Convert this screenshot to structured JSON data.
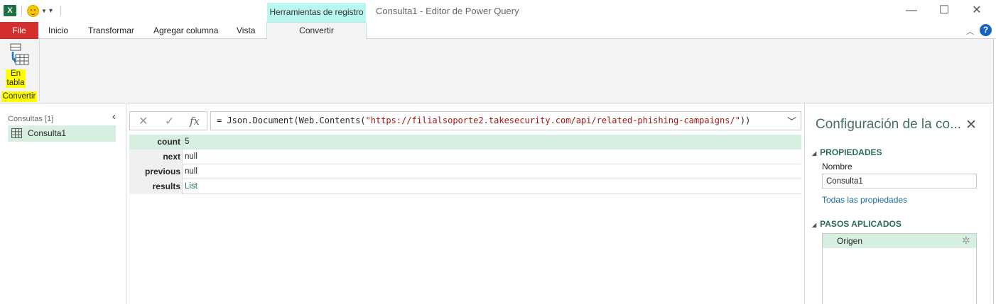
{
  "titlebar": {
    "app_logo": "X",
    "contextual_tab_header": "Herramientas de registro",
    "window_title": "Consulta1 - Editor de Power Query",
    "window_buttons": {
      "minimize": "—",
      "maximize": "☐",
      "close": "✕"
    }
  },
  "tabs": {
    "file": "File",
    "items": [
      "Inicio",
      "Transformar",
      "Agregar columna",
      "Vista"
    ],
    "active": "Convertir"
  },
  "ribbon": {
    "to_table_label": "En tabla",
    "group_label": "Convertir"
  },
  "queries": {
    "header": "Consultas [1]",
    "items": [
      "Consulta1"
    ]
  },
  "formula_bar": {
    "prefix": "= Json.Document(Web.Contents(",
    "url": "\"https://filialsoporte2.takesecurity.com/api/related-phishing-campaigns/\"",
    "suffix": "))"
  },
  "record": {
    "rows": [
      {
        "key": "count",
        "value": "5"
      },
      {
        "key": "next",
        "value": "null"
      },
      {
        "key": "previous",
        "value": "null"
      },
      {
        "key": "results",
        "value": "List"
      }
    ]
  },
  "settings": {
    "title": "Configuración de la co...",
    "properties_head": "PROPIEDADES",
    "name_label": "Nombre",
    "name_value": "Consulta1",
    "all_properties": "Todas las propiedades",
    "steps_head": "PASOS APLICADOS",
    "steps": [
      "Origen"
    ]
  },
  "colors": {
    "file_tab": "#d32f2f",
    "contextual_tab": "#b9f6f0",
    "selection": "#d6efe0",
    "highlight": "#ffff00",
    "accent_text": "#2d6b59"
  }
}
